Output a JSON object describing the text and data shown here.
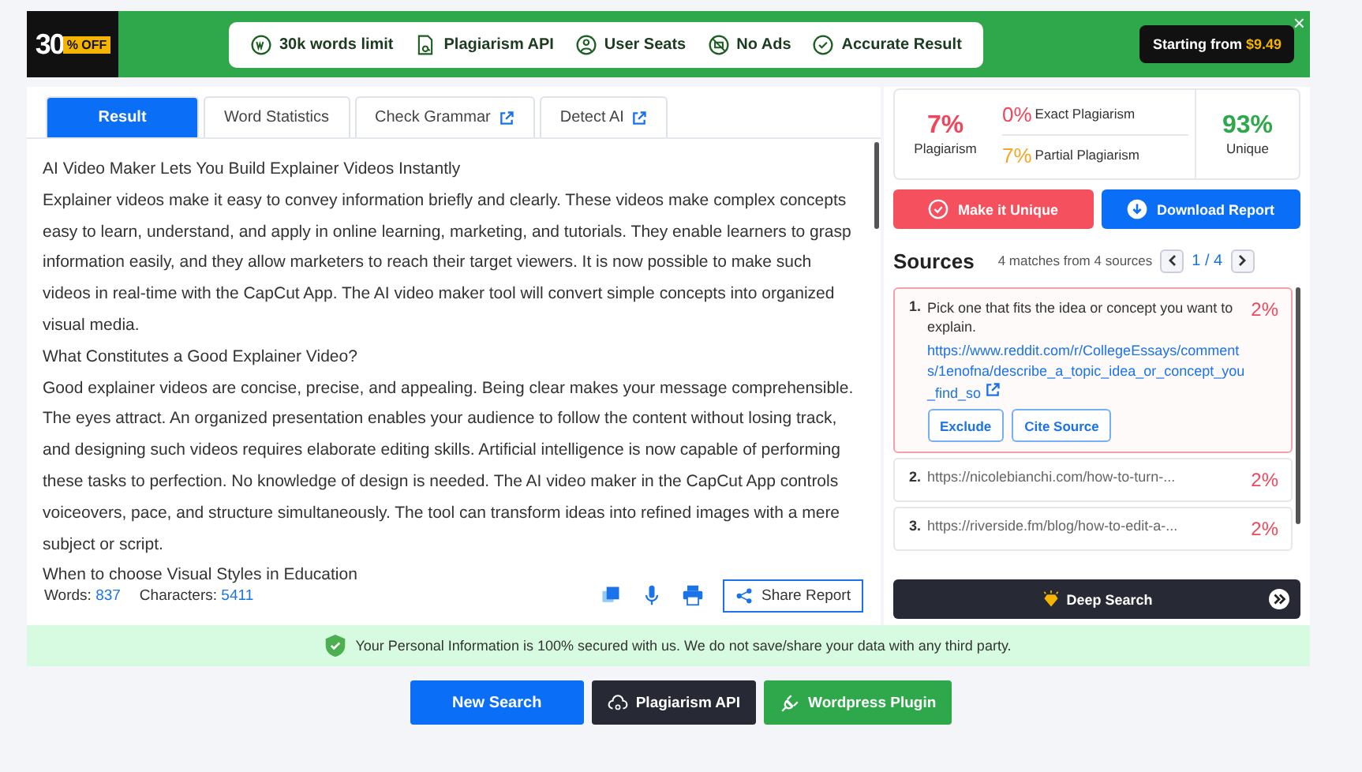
{
  "promo": {
    "badge_number": "30",
    "badge_text": "% OFF",
    "features": [
      {
        "label": "30k words limit"
      },
      {
        "label": "Plagiarism API"
      },
      {
        "label": "User Seats"
      },
      {
        "label": "No Ads"
      },
      {
        "label": "Accurate Result"
      }
    ],
    "price_label": "Starting from",
    "price": "$9.49",
    "close": "×"
  },
  "tabs": [
    {
      "label": "Result",
      "selected": true,
      "external": false
    },
    {
      "label": "Word Statistics",
      "selected": false,
      "external": false
    },
    {
      "label": "Check Grammar",
      "selected": false,
      "external": true
    },
    {
      "label": "Detect AI",
      "selected": false,
      "external": true
    }
  ],
  "paragraphs": [
    "AI Video Maker Lets You Build Explainer Videos Instantly",
    "Explainer videos make it easy to convey information briefly and clearly. These videos make complex concepts easy to learn, understand, and apply in online learning, marketing, and tutorials. They enable learners to grasp information easily, and they allow marketers to reach their target viewers. It is now possible to make such videos in real-time with the CapCut App. The AI video maker tool will convert simple concepts into organized visual media.",
    "What Constitutes a Good Explainer Video?",
    "Good explainer videos are concise, precise, and appealing. Being clear makes your message comprehensible. The eyes attract. An organized presentation enables your audience to follow the content without losing track, and designing such videos requires elaborate editing skills. Artificial intelligence is now capable of performing these tasks to perfection. No knowledge of design is needed. The AI video maker in the CapCut App controls voiceovers, pace, and structure simultaneously. The tool can transform ideas into refined images with a mere subject or script.",
    "When to choose Visual Styles in Education"
  ],
  "counts": [
    {
      "label": "Words:",
      "value": "837"
    },
    {
      "label": "Characters:",
      "value": "5411"
    }
  ],
  "share_button": "Share Report",
  "summary": {
    "plagiarism": "7%",
    "plagiarism_label": "Plagiarism",
    "exact": "0%",
    "exact_label": "Exact Plagiarism",
    "partial": "7%",
    "partial_label": "Partial Plagiarism",
    "unique": "93%",
    "unique_label": "Unique"
  },
  "actions": [
    "Make it Unique",
    "Download Report"
  ],
  "sources": {
    "title": "Sources",
    "summary": "4 matches from 4 sources",
    "page": "1",
    "total": "/ 4",
    "items": [
      {
        "number": "1.",
        "expanded": true,
        "text": "Pick one that fits the idea or concept you want to explain.",
        "url": "https://www.reddit.com/r/CollegeEssays/comments/1enofna/describe_a_topic_idea_or_concept_you_find_so",
        "percent": "2%",
        "buttons": [
          "Exclude",
          "Cite Source"
        ]
      },
      {
        "number": "2.",
        "expanded": false,
        "url": "https://nicolebianchi.com/how-to-turn-...",
        "percent": "2%"
      },
      {
        "number": "3.",
        "expanded": false,
        "url": "https://riverside.fm/blog/how-to-edit-a-...",
        "percent": "2%"
      }
    ]
  },
  "deep_search": "Deep Search",
  "notice": "Your Personal Information is 100% secured with us. We do not save/share your data with any third party.",
  "bottom_buttons": [
    {
      "kind": "primary",
      "label": "New Search"
    },
    {
      "kind": "dark",
      "label": "Plagiarism API"
    },
    {
      "kind": "green",
      "label": "Wordpress Plugin"
    }
  ]
}
